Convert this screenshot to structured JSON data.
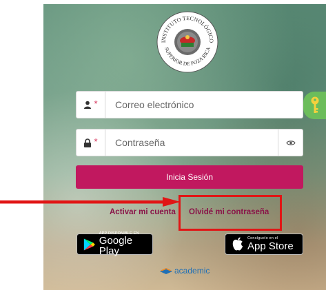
{
  "institution": {
    "seal_text_top": "INSTITUTO TECNOLÓGICO",
    "seal_text_bottom": "SUPERIOR DE POZA RICA"
  },
  "form": {
    "email_placeholder": "Correo electrónico",
    "password_placeholder": "Contraseña",
    "required_mark": "*",
    "login_label": "Inicia Sesión"
  },
  "links": {
    "activate_account": "Activar mi cuenta",
    "forgot_password": "Olvidé mi contraseña"
  },
  "stores": {
    "google_small": "APP DISPONIBLE EN",
    "google_big": "Google Play",
    "apple_small": "Consíguelo en el",
    "apple_big": "App Store"
  },
  "brand": {
    "name": "academic"
  },
  "colors": {
    "accent": "#c1185f",
    "link": "#8a1448",
    "annotation": "#e11515",
    "key_badge": "#6cbd5b"
  }
}
